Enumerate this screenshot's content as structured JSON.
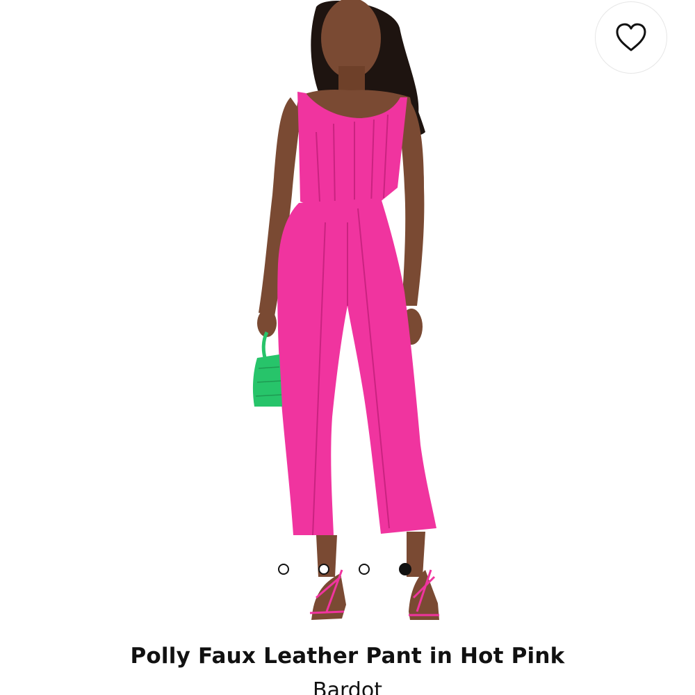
{
  "product": {
    "title": "Polly Faux Leather Pant in Hot Pink",
    "brand": "Bardot",
    "image": {
      "icon": "model-photo",
      "outfit_color": "#f0349f",
      "bag_color": "#27c46a",
      "skin_color": "#7a4a33",
      "hair_color": "#1e1410"
    }
  },
  "wishlist": {
    "icon": "heart-outline-icon"
  },
  "carousel": {
    "total": 4,
    "active_index": 3
  },
  "colors": {
    "text": "#111111",
    "background": "#ffffff"
  }
}
